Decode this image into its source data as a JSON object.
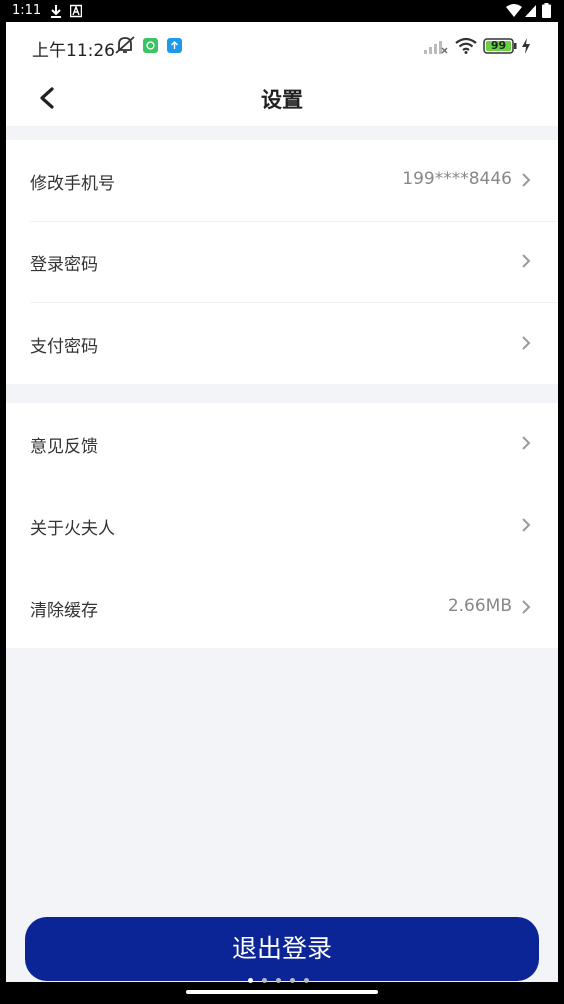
{
  "system_bar": {
    "time": "1:11"
  },
  "inner_status": {
    "time": "上午11:26",
    "battery": "99"
  },
  "header": {
    "title": "设置"
  },
  "settings_group_1": [
    {
      "label": "修改手机号",
      "value": "199****8446"
    },
    {
      "label": "登录密码",
      "value": ""
    },
    {
      "label": "支付密码",
      "value": ""
    }
  ],
  "settings_group_2": [
    {
      "label": "意见反馈",
      "value": ""
    },
    {
      "label": "关于火夫人",
      "value": ""
    },
    {
      "label": "清除缓存",
      "value": "2.66MB"
    }
  ],
  "logout": {
    "label": "退出登录"
  },
  "colors": {
    "primary": "#0b2496",
    "background": "#f3f4f8"
  }
}
